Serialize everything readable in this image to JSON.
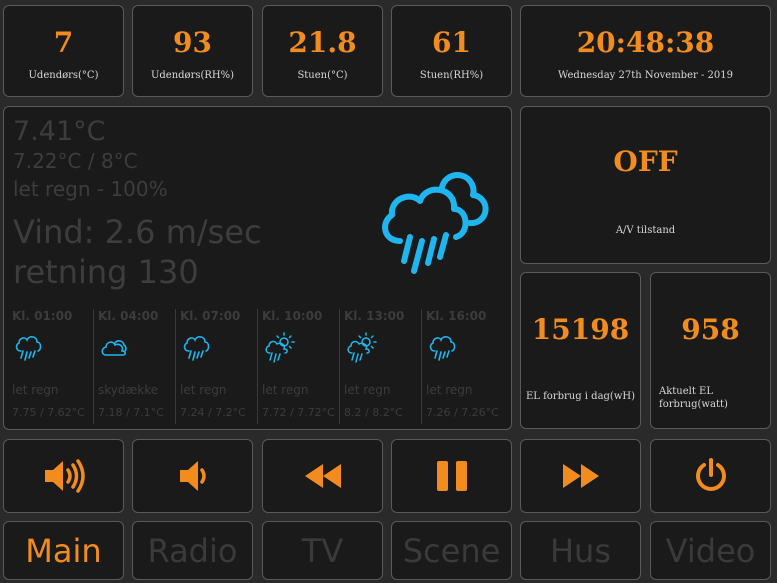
{
  "stats": {
    "outdoor_temp": {
      "value": "7",
      "label": "Udendørs(°C)"
    },
    "outdoor_rh": {
      "value": "93",
      "label": "Udendørs(RH%)"
    },
    "living_temp": {
      "value": "21.8",
      "label": "Stuen(°C)"
    },
    "living_rh": {
      "value": "61",
      "label": "Stuen(RH%)"
    }
  },
  "clock": {
    "time": "20:48:38",
    "date": "Wednesday 27th November - 2019"
  },
  "weather": {
    "temp": "7.41°C",
    "range": "7.22°C / 8°C",
    "desc": "let regn - 100%",
    "wind": "Vind: 2.6 m/sec",
    "direction": "retning 130",
    "icon": "rain-cloud-icon",
    "accent": "#1fb6f0",
    "forecast": [
      {
        "time": "Kl. 01:00",
        "icon": "rain-cloud-icon",
        "desc": "let regn",
        "temp": "7.75 / 7.62°C"
      },
      {
        "time": "Kl. 04:00",
        "icon": "cloud-icon",
        "desc": "skydække",
        "temp": "7.18 / 7.1°C"
      },
      {
        "time": "Kl. 07:00",
        "icon": "rain-cloud-icon",
        "desc": "let regn",
        "temp": "7.24 / 7.2°C"
      },
      {
        "time": "Kl. 10:00",
        "icon": "sun-rain-cloud-icon",
        "desc": "let regn",
        "temp": "7.72 / 7.72°C"
      },
      {
        "time": "Kl. 13:00",
        "icon": "sun-rain-cloud-icon",
        "desc": "let regn",
        "temp": "8.2 / 8.2°C"
      },
      {
        "time": "Kl. 16:00",
        "icon": "rain-cloud-icon",
        "desc": "let regn",
        "temp": "7.26 / 7.26°C"
      }
    ]
  },
  "av": {
    "state": "OFF",
    "label": "A/V tilstand"
  },
  "power": {
    "daily": {
      "value": "15198",
      "label": "EL forbrug i dag(wH)"
    },
    "current": {
      "value": "958",
      "label": "Aktuelt EL forbrug(watt)"
    }
  },
  "controls": [
    {
      "name": "volume-up-button",
      "icon": "volume-up-icon"
    },
    {
      "name": "volume-down-button",
      "icon": "volume-down-icon"
    },
    {
      "name": "rewind-button",
      "icon": "rewind-icon"
    },
    {
      "name": "pause-button",
      "icon": "pause-icon"
    },
    {
      "name": "fast-forward-button",
      "icon": "fast-forward-icon"
    },
    {
      "name": "power-button",
      "icon": "power-icon"
    }
  ],
  "nav": [
    {
      "label": "Main",
      "active": true
    },
    {
      "label": "Radio",
      "active": false
    },
    {
      "label": "TV",
      "active": false
    },
    {
      "label": "Scene",
      "active": false
    },
    {
      "label": "Hus",
      "active": false
    },
    {
      "label": "Video",
      "active": false
    }
  ],
  "colors": {
    "accent": "#f28c1e",
    "weather_icon": "#1fb6f0",
    "tile_bg": "#1a1a1a",
    "border": "#5a5a5a"
  }
}
